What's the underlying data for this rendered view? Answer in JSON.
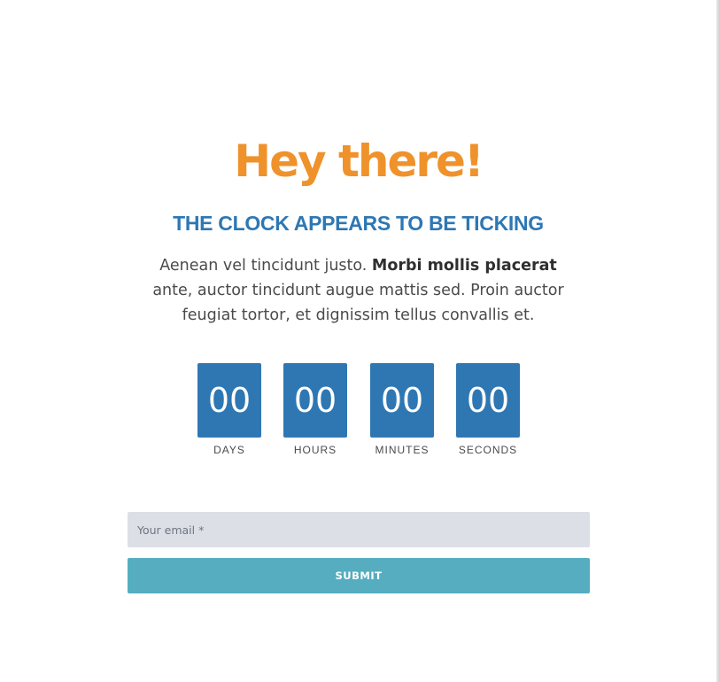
{
  "theme": {
    "headline_color": "#ef922b",
    "subheadline_color": "#2e77b3",
    "countdown_box_color": "#2e77b3",
    "input_background": "#dcdfe5",
    "button_color": "#55adbf"
  },
  "hero": {
    "headline": "Hey there!",
    "subheadline": "THE CLOCK APPEARS TO BE TICKING",
    "paragraph": {
      "text_before": "Aenean vel tincidunt justo. ",
      "bold": "Morbi mollis placerat",
      "text_after": " ante, auctor tincidunt augue mattis sed. Proin auctor feugiat tortor, et dignissim tellus convallis et."
    }
  },
  "countdown": {
    "units": [
      {
        "value": "00",
        "label": "DAYS"
      },
      {
        "value": "00",
        "label": "HOURS"
      },
      {
        "value": "00",
        "label": "MINUTES"
      },
      {
        "value": "00",
        "label": "SECONDS"
      }
    ]
  },
  "form": {
    "email_placeholder": "Your email *",
    "email_value": "",
    "submit_label": "SUBMIT"
  }
}
